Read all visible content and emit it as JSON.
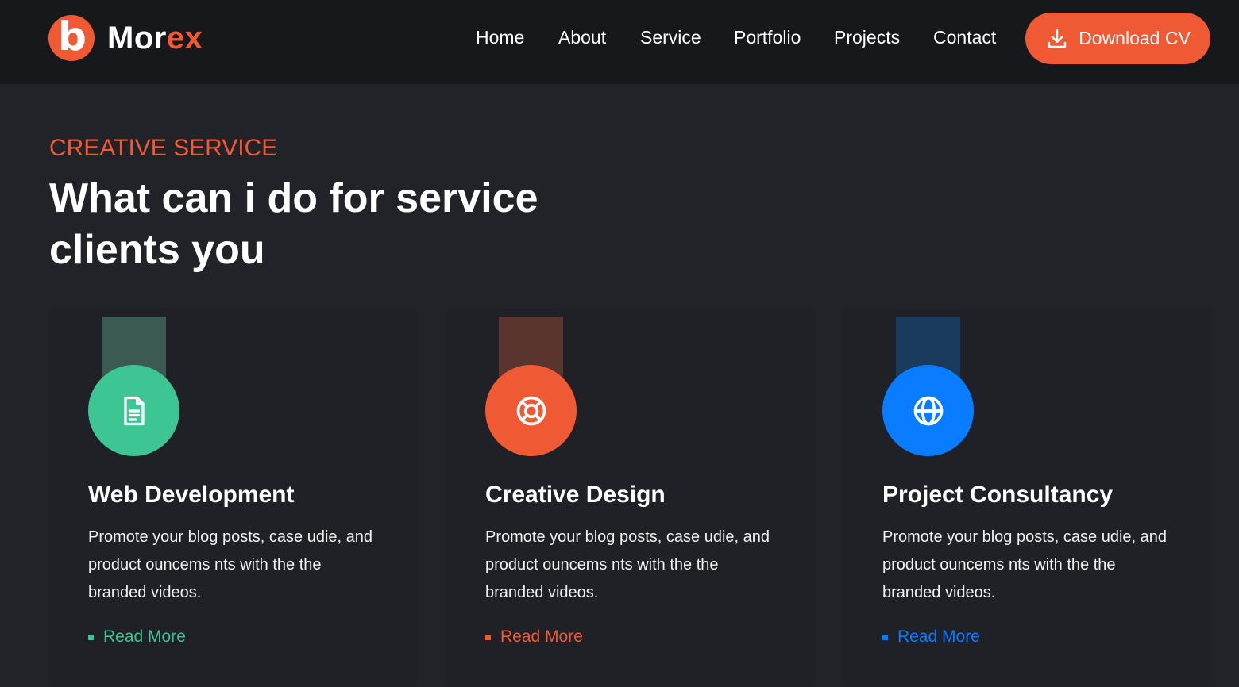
{
  "header": {
    "logo_letter": "b",
    "logo_text_main": "Mor",
    "logo_text_accent": "ex",
    "nav": [
      "Home",
      "About",
      "Service",
      "Portfolio",
      "Projects",
      "Contact"
    ],
    "cta_label": "Download CV",
    "cta_icon": "download-icon"
  },
  "section": {
    "eyebrow": "CREATIVE SERVICE",
    "heading_line1": "What can i do for service",
    "heading_line2": "clients you"
  },
  "cards": [
    {
      "title": "Web Development",
      "text": "Promote your blog posts, case udie, and product ouncems nts with the the branded videos.",
      "link": "Read More",
      "icon": "document-icon",
      "color": "#3ec594",
      "tab_color": "#3a5a52"
    },
    {
      "title": "Creative Design",
      "text": "Promote your blog posts, case udie, and product ouncems nts with the the branded videos.",
      "link": "Read More",
      "icon": "lifebuoy-icon",
      "color": "#ef5a35",
      "tab_color": "#5a342e"
    },
    {
      "title": "Project Consultancy",
      "text": "Promote your blog posts, case udie, and product ouncems nts with the the branded videos.",
      "link": "Read More",
      "icon": "globe-icon",
      "color": "#0a7cff",
      "tab_color": "#1a3a5e"
    }
  ],
  "colors": {
    "accent": "#ef5a35",
    "header_bg": "#17181c",
    "page_bg": "#212328"
  }
}
